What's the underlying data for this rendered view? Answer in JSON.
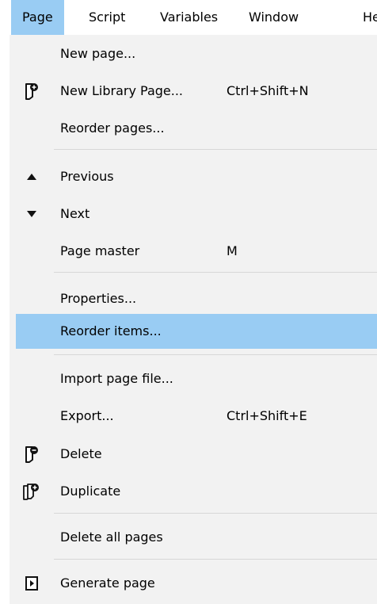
{
  "menubar": {
    "items": [
      {
        "label": "Page"
      },
      {
        "label": "Script"
      },
      {
        "label": "Variables"
      },
      {
        "label": "Window"
      },
      {
        "label": "He"
      }
    ]
  },
  "menu": {
    "items": [
      {
        "label": "New page..."
      },
      {
        "label": "New Library Page...",
        "shortcut": "Ctrl+Shift+N",
        "icon": "new-library-page-icon"
      },
      {
        "label": "Reorder pages..."
      },
      {
        "label": "Previous",
        "icon": "triangle-up-icon"
      },
      {
        "label": "Next",
        "icon": "triangle-down-icon"
      },
      {
        "label": "Page master",
        "shortcut": "M"
      },
      {
        "label": "Properties..."
      },
      {
        "label": "Reorder items...",
        "highlighted": true
      },
      {
        "label": "Import page file..."
      },
      {
        "label": "Export...",
        "shortcut": "Ctrl+Shift+E"
      },
      {
        "label": "Delete",
        "icon": "delete-page-icon"
      },
      {
        "label": "Duplicate",
        "icon": "duplicate-page-icon"
      },
      {
        "label": "Delete all pages"
      },
      {
        "label": "Generate page",
        "icon": "generate-page-icon"
      }
    ]
  },
  "colors": {
    "highlight": "#99ccf3",
    "menu_background": "#f2f2f2",
    "separator": "#d7d7d7"
  }
}
